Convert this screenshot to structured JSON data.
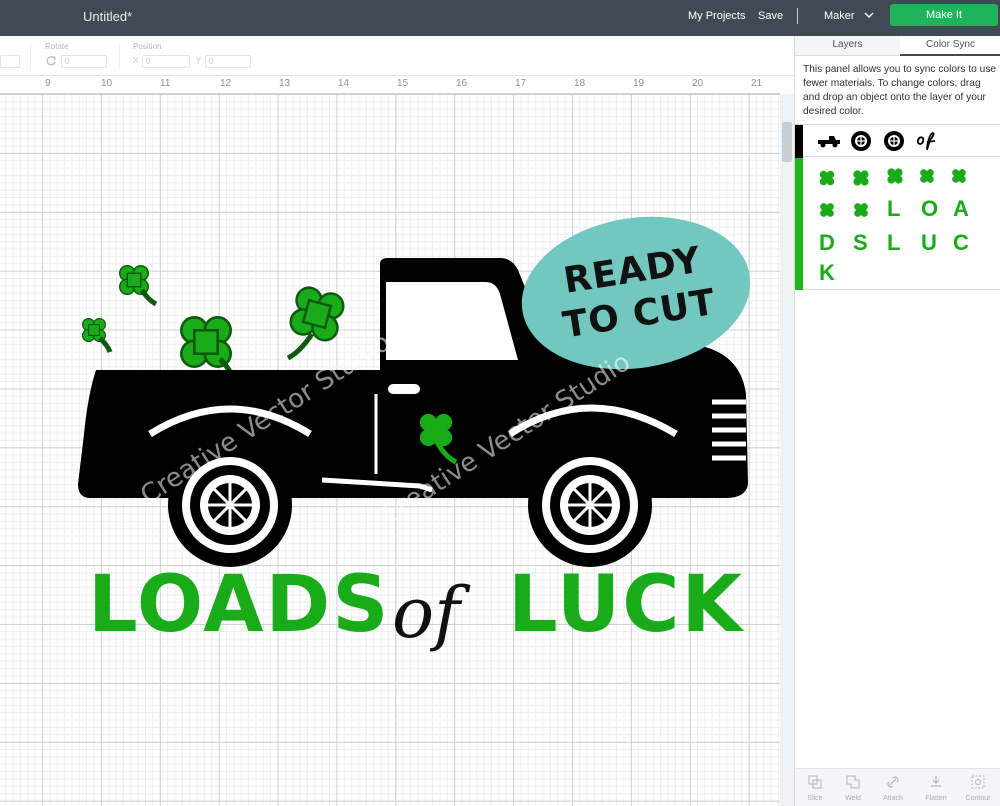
{
  "header": {
    "doc_title": "Untitled*",
    "my_projects": "My Projects",
    "save": "Save",
    "separator": "|",
    "machine": "Maker",
    "make_it": "Make It"
  },
  "toolbar": {
    "rotate_label": "Rotate",
    "rotate_value": "0",
    "position_label": "Position",
    "x_label": "X",
    "x_value": "0",
    "y_label": "Y",
    "y_value": "0"
  },
  "ruler": {
    "marks": [
      "9",
      "10",
      "11",
      "12",
      "13",
      "14",
      "15",
      "16",
      "17",
      "18",
      "19",
      "20",
      "21"
    ]
  },
  "panel": {
    "tabs": [
      "Layers",
      "Color Sync"
    ],
    "description": "This panel allows you to sync colors to use fewer materials. To change colors, drag and drop an object onto the layer of your desired color.",
    "black_layer_items": [
      "truck-icon",
      "wheel-icon",
      "wheel-icon",
      "of-text-icon"
    ],
    "green_letters": [
      "L",
      "O",
      "A",
      "D",
      "S",
      "L",
      "U",
      "C",
      "K"
    ],
    "tools": [
      "Slice",
      "Weld",
      "Attach",
      "Flatten",
      "Contour"
    ]
  },
  "canvas": {
    "badge_line1": "READY",
    "badge_line2": "TO CUT",
    "word1": "LOADS",
    "word_of": "of",
    "word2": "LUCK",
    "watermark": "Creative Vector Studio"
  },
  "colors": {
    "topbar": "#414a52",
    "make_it": "#1fb35c",
    "shamrock": "#1aab1a",
    "badge": "#72c7bf",
    "truck": "#000000"
  }
}
